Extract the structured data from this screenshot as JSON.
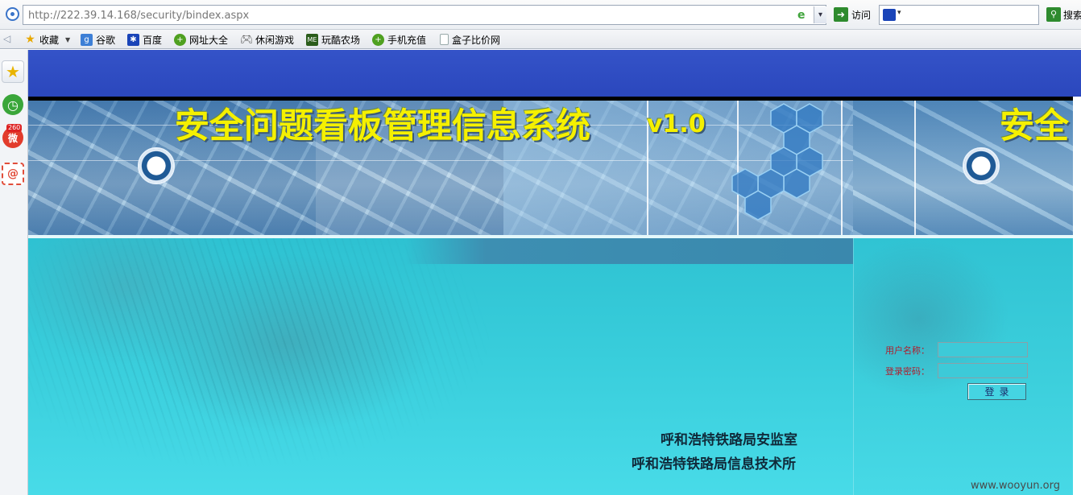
{
  "browser": {
    "address": "http://222.39.14.168/security/bindex.aspx",
    "go_label": "访问",
    "search_label": "搜索",
    "search_value": ""
  },
  "bookmarks": {
    "items": [
      {
        "label": "收藏",
        "icon": "star-icon"
      },
      {
        "label": "谷歌",
        "icon": "google-icon"
      },
      {
        "label": "百度",
        "icon": "baidu-paw-icon"
      },
      {
        "label": "网址大全",
        "icon": "green-globe-icon"
      },
      {
        "label": "休闲游戏",
        "icon": "gamepad-icon"
      },
      {
        "label": "玩酷农场",
        "icon": "me-icon"
      },
      {
        "label": "手机充值",
        "icon": "green-globe-icon"
      },
      {
        "label": "盒子比价网",
        "icon": "page-icon"
      }
    ]
  },
  "sidebar": {
    "weibo_badge": "260"
  },
  "page": {
    "banner_title": "安全问题看板管理信息系统",
    "banner_version": "v1.0",
    "banner_title_repeat": "安全",
    "org_line1": "呼和浩特铁路局安监室",
    "org_line2": "呼和浩特铁路局信息技术所",
    "login": {
      "username_label": "用户名称：",
      "password_label": "登录密码：",
      "username_value": "",
      "password_value": "",
      "submit_label": "登录"
    },
    "colors": {
      "title": "#f5f000",
      "top_band": "#3453c8",
      "body": "#40d6e4",
      "label": "#b01c2c"
    }
  },
  "watermark": "www.wooyun.org"
}
